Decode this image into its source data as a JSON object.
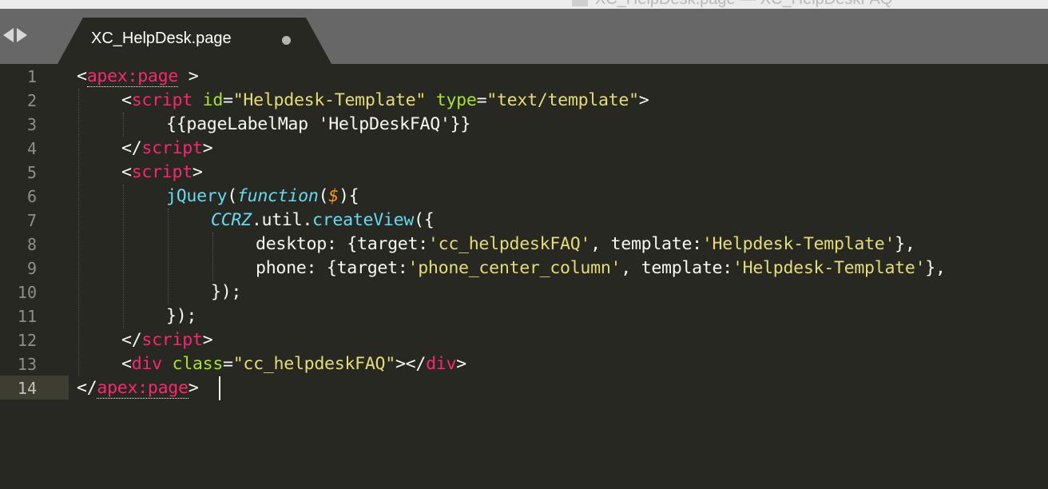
{
  "window": {
    "title": "XC_HelpDesk.page — XC_HelpDeskFAQ"
  },
  "tabs": [
    {
      "label": "XC_HelpDesk.page",
      "dirty": true
    }
  ],
  "nav": {
    "back_icon": "arrow-left-icon",
    "forward_icon": "arrow-right-icon"
  },
  "theme": {
    "background": "#272822",
    "tag": "#f92672",
    "attribute": "#a6e22e",
    "string": "#e6db74",
    "function": "#66d9ef",
    "parameter": "#fd971f",
    "text": "#f8f8f2"
  },
  "editor": {
    "active_line": 14,
    "line_numbers": [
      "1",
      "2",
      "3",
      "4",
      "5",
      "6",
      "7",
      "8",
      "9",
      "10",
      "11",
      "12",
      "13",
      "14"
    ],
    "lines": [
      [
        {
          "t": "p",
          "v": "<"
        },
        {
          "t": "tag",
          "v": "apex:page"
        },
        {
          "t": "p",
          "v": " >"
        }
      ],
      [
        {
          "t": "p",
          "v": "<"
        },
        {
          "t": "tag",
          "v": "script"
        },
        {
          "t": "p",
          "v": " "
        },
        {
          "t": "attr",
          "v": "id"
        },
        {
          "t": "p",
          "v": "="
        },
        {
          "t": "str",
          "v": "\"Helpdesk-Template\""
        },
        {
          "t": "p",
          "v": " "
        },
        {
          "t": "attr",
          "v": "type"
        },
        {
          "t": "p",
          "v": "="
        },
        {
          "t": "str",
          "v": "\"text/template\""
        },
        {
          "t": "p",
          "v": ">"
        }
      ],
      [
        {
          "t": "p",
          "v": "{{pageLabelMap 'HelpDeskFAQ'}}"
        }
      ],
      [
        {
          "t": "p",
          "v": "</"
        },
        {
          "t": "tag",
          "v": "script"
        },
        {
          "t": "p",
          "v": ">"
        }
      ],
      [
        {
          "t": "p",
          "v": "<"
        },
        {
          "t": "tag",
          "v": "script"
        },
        {
          "t": "p",
          "v": ">"
        }
      ],
      [
        {
          "t": "fn",
          "v": "jQuery"
        },
        {
          "t": "p",
          "v": "("
        },
        {
          "t": "kw",
          "v": "function"
        },
        {
          "t": "p",
          "v": "("
        },
        {
          "t": "param",
          "v": "$"
        },
        {
          "t": "p",
          "v": "){"
        }
      ],
      [
        {
          "t": "kw",
          "v": "CCRZ"
        },
        {
          "t": "p",
          "v": ".util."
        },
        {
          "t": "fn",
          "v": "createView"
        },
        {
          "t": "p",
          "v": "({"
        }
      ],
      [
        {
          "t": "p",
          "v": "desktop: {target:"
        },
        {
          "t": "str",
          "v": "'cc_helpdeskFAQ'"
        },
        {
          "t": "p",
          "v": ", template:"
        },
        {
          "t": "str",
          "v": "'Helpdesk-Template'"
        },
        {
          "t": "p",
          "v": "},"
        }
      ],
      [
        {
          "t": "p",
          "v": "phone: {target:"
        },
        {
          "t": "str",
          "v": "'phone_center_column'"
        },
        {
          "t": "p",
          "v": ", template:"
        },
        {
          "t": "str",
          "v": "'Helpdesk-Template'"
        },
        {
          "t": "p",
          "v": "},"
        }
      ],
      [
        {
          "t": "p",
          "v": "});"
        }
      ],
      [
        {
          "t": "p",
          "v": "});"
        }
      ],
      [
        {
          "t": "p",
          "v": "</"
        },
        {
          "t": "tag",
          "v": "script"
        },
        {
          "t": "p",
          "v": ">"
        }
      ],
      [
        {
          "t": "p",
          "v": "<"
        },
        {
          "t": "tag",
          "v": "div"
        },
        {
          "t": "p",
          "v": " "
        },
        {
          "t": "attr",
          "v": "class"
        },
        {
          "t": "p",
          "v": "="
        },
        {
          "t": "str",
          "v": "\"cc_helpdeskFAQ\""
        },
        {
          "t": "p",
          "v": "></"
        },
        {
          "t": "tag",
          "v": "div"
        },
        {
          "t": "p",
          "v": ">"
        }
      ],
      [
        {
          "t": "p",
          "v": "</"
        },
        {
          "t": "tag",
          "v": "apex:page"
        },
        {
          "t": "p",
          "v": ">"
        }
      ]
    ]
  }
}
